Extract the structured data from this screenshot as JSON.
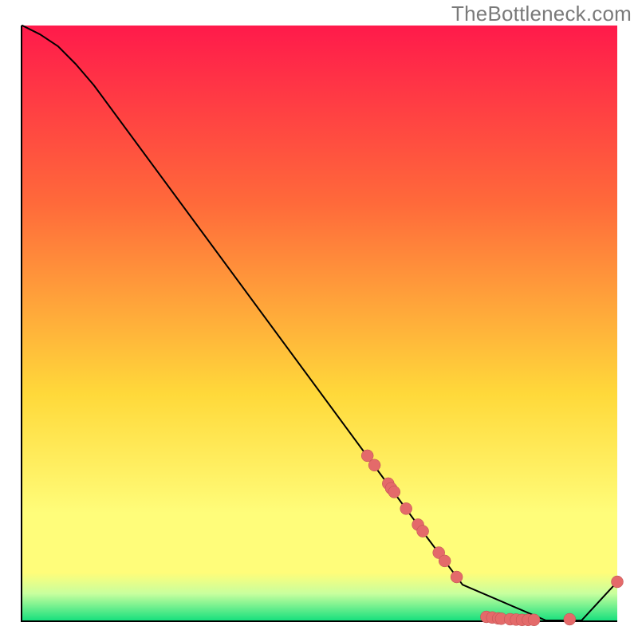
{
  "watermark": "TheBottleneck.com",
  "colors": {
    "grad_top": "#ff1a4b",
    "grad_mid1": "#ff6a3a",
    "grad_mid2": "#ffd93a",
    "grad_mid3": "#fffd7a",
    "grad_band": "#c8ff9e",
    "grad_bottom": "#18e07e",
    "line": "#000000",
    "dot_fill": "#e46a6a",
    "dot_stroke": "#b94f4f"
  },
  "chart_data": {
    "type": "line",
    "title": "",
    "xlabel": "",
    "ylabel": "",
    "xlim": [
      0,
      100
    ],
    "ylim": [
      0,
      100
    ],
    "series": [
      {
        "name": "curve",
        "x": [
          0,
          3,
          6,
          9,
          12,
          68,
          74,
          88,
          94,
          100
        ],
        "y": [
          100,
          98.5,
          96.5,
          93.5,
          90,
          14,
          6,
          0,
          0,
          6.5
        ]
      }
    ],
    "scatter_clusters": [
      {
        "name": "upper-dots",
        "points": [
          {
            "x": 58.0,
            "y": 27.7
          },
          {
            "x": 59.2,
            "y": 26.1
          },
          {
            "x": 61.5,
            "y": 23.0
          },
          {
            "x": 62.0,
            "y": 22.2
          },
          {
            "x": 62.5,
            "y": 21.6
          },
          {
            "x": 64.5,
            "y": 18.8
          },
          {
            "x": 66.5,
            "y": 16.1
          },
          {
            "x": 67.3,
            "y": 15.0
          },
          {
            "x": 70.0,
            "y": 11.4
          },
          {
            "x": 71.0,
            "y": 10.0
          },
          {
            "x": 73.0,
            "y": 7.3
          }
        ]
      },
      {
        "name": "bottom-dots",
        "points": [
          {
            "x": 78.0,
            "y": 0.6
          },
          {
            "x": 79.0,
            "y": 0.5
          },
          {
            "x": 80.0,
            "y": 0.35
          },
          {
            "x": 80.5,
            "y": 0.3
          },
          {
            "x": 82.0,
            "y": 0.2
          },
          {
            "x": 83.0,
            "y": 0.15
          },
          {
            "x": 84.0,
            "y": 0.1
          },
          {
            "x": 85.0,
            "y": 0.1
          },
          {
            "x": 86.0,
            "y": 0.1
          },
          {
            "x": 92.0,
            "y": 0.2
          },
          {
            "x": 100.0,
            "y": 6.5
          }
        ]
      }
    ],
    "gradient_stops": [
      {
        "offset": 0,
        "key": "grad_top"
      },
      {
        "offset": 30,
        "key": "grad_mid1"
      },
      {
        "offset": 62,
        "key": "grad_mid2"
      },
      {
        "offset": 82,
        "key": "grad_mid3"
      },
      {
        "offset": 92,
        "key": "grad_mid3"
      },
      {
        "offset": 95.5,
        "key": "grad_band"
      },
      {
        "offset": 100,
        "key": "grad_bottom"
      }
    ]
  }
}
